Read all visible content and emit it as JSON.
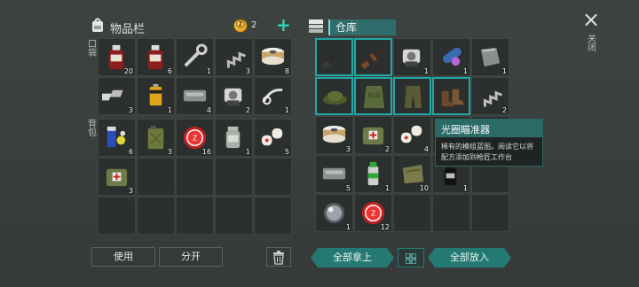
{
  "header": {
    "inventory_title": "物品栏",
    "coins": "2",
    "plus": "+",
    "storage_title": "仓库",
    "close_label": "关闭",
    "close_icon": "×"
  },
  "side_labels": {
    "pocket": "口袋",
    "backpack": "背包"
  },
  "pocket_slots": [
    {
      "icon": "blood-bottle",
      "count": "20"
    },
    {
      "icon": "blood-bottle",
      "count": "6"
    },
    {
      "icon": "wrench",
      "count": "1"
    },
    {
      "icon": "spring",
      "count": "3"
    },
    {
      "icon": "thread-spool",
      "count": "8"
    },
    {
      "icon": "scrap-metal",
      "count": "3"
    },
    {
      "icon": "battery",
      "count": "1"
    },
    {
      "icon": "metal-plate",
      "count": "4"
    },
    {
      "icon": "engine-part",
      "count": "2"
    },
    {
      "icon": "scope-part",
      "count": "1"
    }
  ],
  "backpack_slots": [
    {
      "icon": "pills",
      "count": "6"
    },
    {
      "icon": "jerrycan",
      "count": "3"
    },
    {
      "icon": "bottle-cap",
      "count": "16"
    },
    {
      "icon": "jar",
      "count": "1"
    },
    {
      "icon": "bandage",
      "count": "5"
    },
    {
      "icon": "medkit-bag",
      "count": "3"
    },
    {
      "icon": "",
      "count": ""
    },
    {
      "icon": "",
      "count": ""
    },
    {
      "icon": "",
      "count": ""
    },
    {
      "icon": "",
      "count": ""
    },
    {
      "icon": "",
      "count": ""
    },
    {
      "icon": "",
      "count": ""
    },
    {
      "icon": "",
      "count": ""
    },
    {
      "icon": "",
      "count": ""
    },
    {
      "icon": "",
      "count": ""
    }
  ],
  "storage_slots": [
    {
      "icon": "rifle",
      "count": "",
      "hl": true
    },
    {
      "icon": "ak-rifle",
      "count": "",
      "hl": true
    },
    {
      "icon": "engine-part",
      "count": "1",
      "hl": false
    },
    {
      "icon": "blueprint-roll",
      "count": "1",
      "hl": false
    },
    {
      "icon": "metal-chunk",
      "count": "1",
      "hl": false
    },
    {
      "icon": "cap-hat",
      "count": "",
      "hl": true
    },
    {
      "icon": "vest",
      "count": "",
      "hl": true
    },
    {
      "icon": "pants",
      "count": "",
      "hl": true
    },
    {
      "icon": "boots",
      "count": "",
      "hl": true
    },
    {
      "icon": "spring",
      "count": "2",
      "hl": false
    },
    {
      "icon": "thread-spool",
      "count": "3",
      "hl": false
    },
    {
      "icon": "medkit-bag",
      "count": "2",
      "hl": false
    },
    {
      "icon": "bandage",
      "count": "4",
      "hl": false
    },
    {
      "icon": "",
      "count": "",
      "hl": false
    },
    {
      "icon": "blueprint",
      "count": "1",
      "hl": false
    },
    {
      "icon": "metal-plate",
      "count": "5",
      "hl": false
    },
    {
      "icon": "spray-can",
      "count": "1",
      "hl": false
    },
    {
      "icon": "cloth-bag",
      "count": "10",
      "hl": false
    },
    {
      "icon": "bottle",
      "count": "1",
      "hl": false
    },
    {
      "icon": "",
      "count": "",
      "hl": false
    },
    {
      "icon": "lens",
      "count": "1",
      "hl": false
    },
    {
      "icon": "bottle-cap",
      "count": "12",
      "hl": false
    },
    {
      "icon": "",
      "count": "",
      "hl": false
    },
    {
      "icon": "",
      "count": "",
      "hl": false
    },
    {
      "icon": "",
      "count": "",
      "hl": false
    }
  ],
  "buttons": {
    "use": "使用",
    "split": "分开",
    "take_all": "全部拿上",
    "put_all": "全部放入",
    "trash_icon": "trash-icon",
    "sort_icon": "grid-sort-icon"
  },
  "tooltip": {
    "title": "光圈瞄准器",
    "description": "稀有的模组蓝图。阅读它以将配方添加到枪匠工作台"
  },
  "colors": {
    "accent": "#247a72",
    "highlight_border": "#20a8a4",
    "coin": "#e8a31c"
  }
}
